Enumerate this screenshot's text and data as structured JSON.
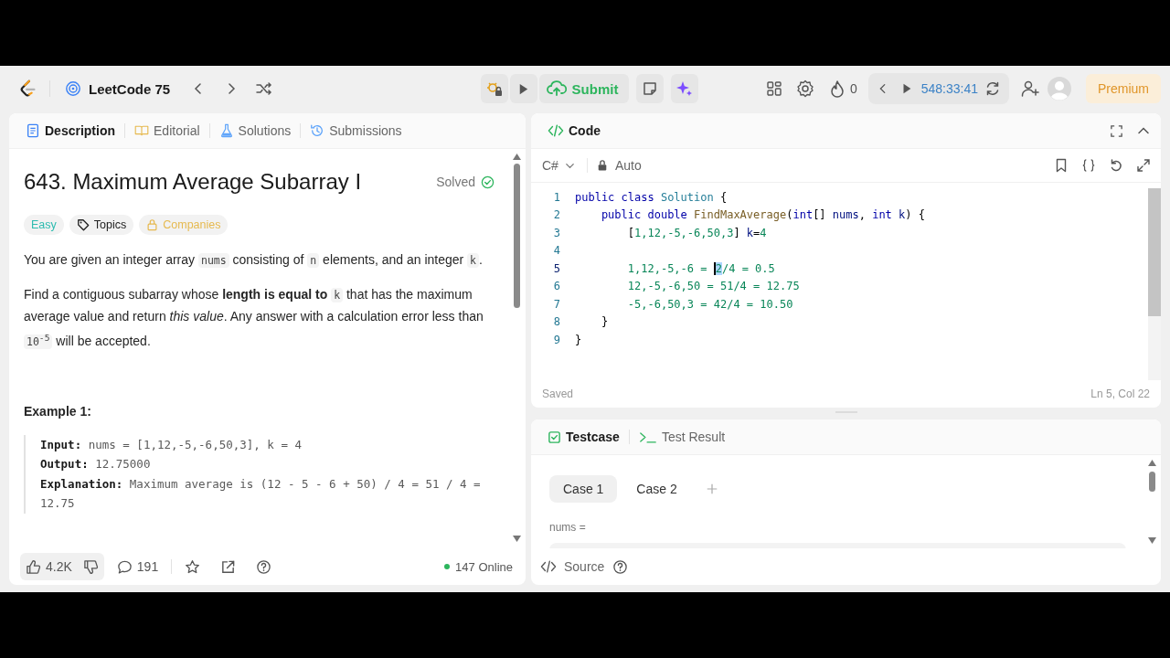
{
  "nav": {
    "study_plan": "LeetCode 75",
    "submit": "Submit",
    "streak": "0",
    "timer": "548:33:41",
    "premium": "Premium"
  },
  "left_tabs": [
    {
      "label": "Description",
      "selected": true,
      "kind": "doc"
    },
    {
      "label": "Editorial",
      "selected": false,
      "kind": "book"
    },
    {
      "label": "Solutions",
      "selected": false,
      "kind": "flask"
    },
    {
      "label": "Submissions",
      "selected": false,
      "kind": "history"
    }
  ],
  "problem": {
    "title": "643. Maximum Average Subarray I",
    "status": "Solved",
    "tags": [
      {
        "label": "Easy",
        "kind": "difficulty"
      },
      {
        "label": "Topics",
        "kind": "topics"
      },
      {
        "label": "Companies",
        "kind": "locked"
      }
    ],
    "paragraphs": [
      [
        {
          "kind": "text",
          "text": "You are given an integer array "
        },
        {
          "kind": "code",
          "text": "nums"
        },
        {
          "kind": "text",
          "text": " consisting of "
        },
        {
          "kind": "code",
          "text": "n"
        },
        {
          "kind": "text",
          "text": " elements, and an integer "
        },
        {
          "kind": "code",
          "text": "k"
        },
        {
          "kind": "text",
          "text": "."
        }
      ],
      [
        {
          "kind": "text",
          "text": "Find a contiguous subarray whose **length is equal to** "
        },
        {
          "kind": "code",
          "text": "k"
        },
        {
          "kind": "text",
          "text": " that has the maximum average value and return *this value*. Any answer with a calculation error less than "
        },
        {
          "kind": "code",
          "text": "10$^{-5}$"
        },
        {
          "kind": "text",
          "text": " will be accepted."
        }
      ]
    ],
    "examples": [
      {
        "heading": "Example 1:",
        "lines": [
          {
            "label": "Input:",
            "value": "nums = [1,12,-5,-6,50,3], k = 4"
          },
          {
            "label": "Output:",
            "value": "12.75000"
          },
          {
            "label": "Explanation:",
            "value": "Maximum average is (12 - 5 - 6 + 50) / 4 = 51 / 4 = 12.75"
          }
        ]
      }
    ]
  },
  "footer": {
    "likes": "4.2K",
    "comments": "191",
    "online": "147 Online"
  },
  "code": {
    "title": "Code",
    "language": "C#",
    "mode": "Auto",
    "status": "Saved",
    "position": "Ln 5, Col 22",
    "lines": [
      {
        "n": "1",
        "current": false,
        "tokens": [
          {
            "kind": "kw",
            "text": "public class "
          },
          {
            "kind": "type",
            "text": "Solution"
          },
          {
            "kind": "punc",
            "text": " {"
          }
        ]
      },
      {
        "n": "2",
        "current": false,
        "tokens": [
          {
            "kind": "kw",
            "text": "    public double "
          },
          {
            "kind": "fn",
            "text": "FindMaxAverage"
          },
          {
            "kind": "punc",
            "text": "("
          },
          {
            "kind": "kw",
            "text": "int"
          },
          {
            "kind": "punc",
            "text": "[] "
          },
          {
            "kind": "id",
            "text": "nums"
          },
          {
            "kind": "punc",
            "text": ", "
          },
          {
            "kind": "kw",
            "text": "int "
          },
          {
            "kind": "id",
            "text": "k"
          },
          {
            "kind": "punc",
            "text": ") {"
          }
        ]
      },
      {
        "n": "3",
        "current": false,
        "tokens": [
          {
            "kind": "punc",
            "text": "        ["
          },
          {
            "kind": "num",
            "text": "1,12,-5,-6,50,3"
          },
          {
            "kind": "punc",
            "text": "] "
          },
          {
            "kind": "id",
            "text": "k"
          },
          {
            "kind": "punc",
            "text": "="
          },
          {
            "kind": "num",
            "text": "4"
          }
        ]
      },
      {
        "n": "4",
        "current": false
      },
      {
        "n": "5",
        "current": true,
        "tokens": [
          {
            "kind": "num",
            "text": "        1,12,-5,-6 = "
          },
          {
            "kind": "sel",
            "text": "2"
          },
          {
            "kind": "num",
            "text": "/4 = 0.5"
          }
        ]
      },
      {
        "n": "6",
        "current": false,
        "tokens": [
          {
            "kind": "num",
            "text": "        12,-5,-6,50 = 51/4 = 12.75"
          }
        ]
      },
      {
        "n": "7",
        "current": false,
        "tokens": [
          {
            "kind": "num",
            "text": "        -5,-6,50,3 = 42/4 = 10.50"
          }
        ]
      },
      {
        "n": "8",
        "current": false,
        "tokens": [
          {
            "kind": "punc",
            "text": "    }"
          }
        ]
      },
      {
        "n": "9",
        "current": false,
        "tokens": [
          {
            "kind": "punc",
            "text": "}"
          }
        ]
      }
    ]
  },
  "testcase": {
    "tabs": [
      {
        "label": "Testcase",
        "selected": true,
        "kind": "check"
      },
      {
        "label": "Test Result",
        "selected": false,
        "kind": "terminal"
      }
    ],
    "cases": [
      {
        "label": "Case 1",
        "selected": true
      },
      {
        "label": "Case 2",
        "selected": false
      }
    ],
    "field_label": "nums =",
    "source": "Source"
  }
}
